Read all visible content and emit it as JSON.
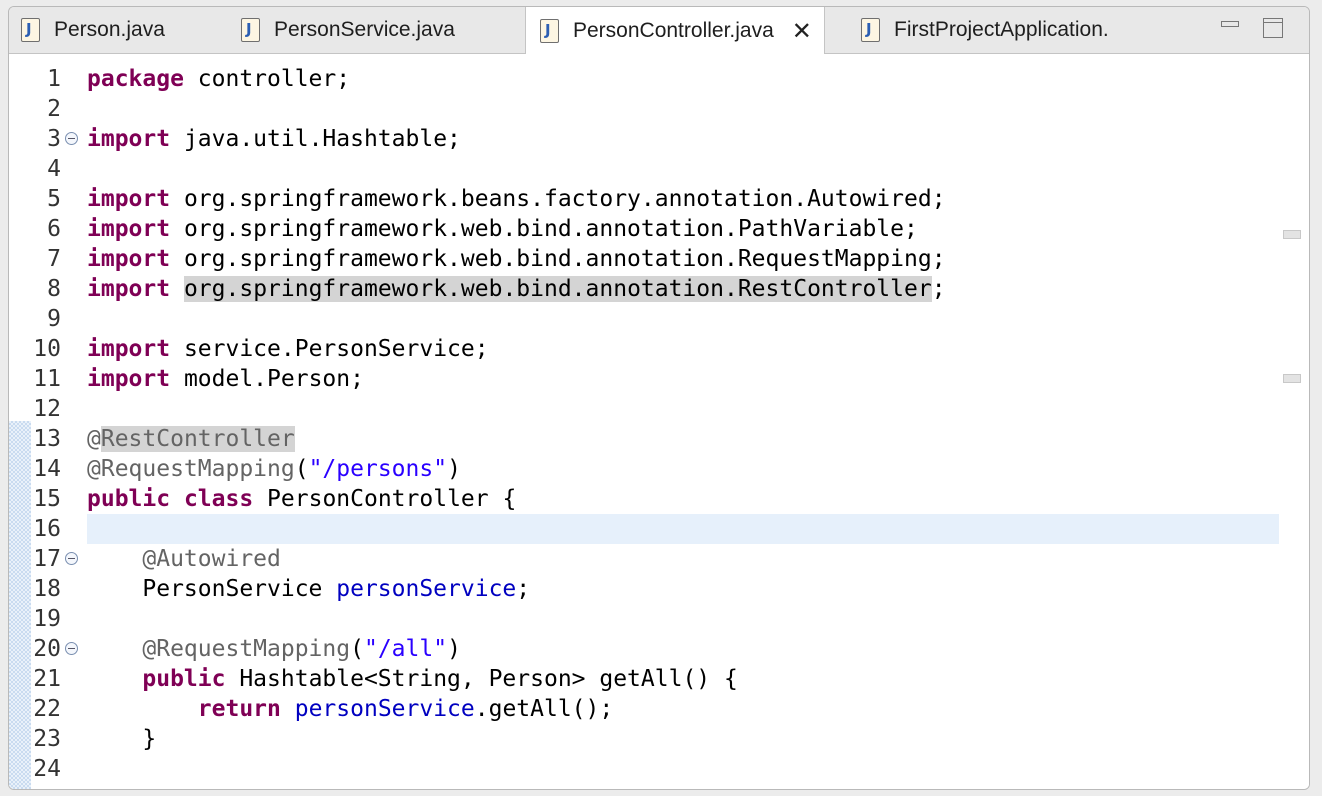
{
  "tabs": [
    {
      "label": "Person.java"
    },
    {
      "label": "PersonService.java"
    },
    {
      "label": "PersonController.java"
    },
    {
      "label": "FirstProjectApplication."
    }
  ],
  "editor": {
    "lines": [
      {
        "n": "1",
        "html": "<span class=\"kw\">package</span> controller;"
      },
      {
        "n": "2",
        "html": ""
      },
      {
        "n": "3",
        "html": "<span class=\"kw\">import</span> java.util.Hashtable;",
        "fold": true
      },
      {
        "n": "4",
        "html": ""
      },
      {
        "n": "5",
        "html": "<span class=\"kw\">import</span> org.springframework.beans.factory.annotation.Autowired;"
      },
      {
        "n": "6",
        "html": "<span class=\"kw\">import</span> org.springframework.web.bind.annotation.PathVariable;"
      },
      {
        "n": "7",
        "html": "<span class=\"kw\">import</span> org.springframework.web.bind.annotation.RequestMapping;"
      },
      {
        "n": "8",
        "html": "<span class=\"kw\">import</span> <span class=\"hl\">org.springframework.web.bind.annotation.RestController</span>;"
      },
      {
        "n": "9",
        "html": ""
      },
      {
        "n": "10",
        "html": "<span class=\"kw\">import</span> service.PersonService;"
      },
      {
        "n": "11",
        "html": "<span class=\"kw\">import</span> model.Person;"
      },
      {
        "n": "12",
        "html": ""
      },
      {
        "n": "13",
        "html": "<span class=\"ann\">@<span class=\"hl\">RestController</span></span>"
      },
      {
        "n": "14",
        "html": "<span class=\"ann\">@RequestMapping</span>(<span class=\"str\">\"/persons\"</span>)"
      },
      {
        "n": "15",
        "html": "<span class=\"kw\">public</span> <span class=\"kw\">class</span> PersonController {"
      },
      {
        "n": "16",
        "html": "",
        "current": true
      },
      {
        "n": "17",
        "html": "    <span class=\"ann\">@Autowired</span>",
        "fold": true
      },
      {
        "n": "18",
        "html": "    PersonService <span class=\"fld\">personService</span>;"
      },
      {
        "n": "19",
        "html": ""
      },
      {
        "n": "20",
        "html": "    <span class=\"ann\">@RequestMapping</span>(<span class=\"str\">\"/all\"</span>)",
        "fold": true
      },
      {
        "n": "21",
        "html": "    <span class=\"kw\">public</span> Hashtable&lt;String, Person&gt; getAll() {"
      },
      {
        "n": "22",
        "html": "        <span class=\"kw\">return</span> <span class=\"fld\">personService</span>.getAll();"
      },
      {
        "n": "23",
        "html": "    }"
      },
      {
        "n": "24",
        "html": ""
      }
    ]
  },
  "colors": {
    "keyword": "#7f0055",
    "annotation": "#646464",
    "string": "#2a00ff",
    "field": "#0000c0",
    "current_line": "#e6f0fb",
    "occurrence_highlight": "#d4d4d4"
  },
  "icons": [
    "java-file-icon",
    "close-icon",
    "minimize-icon",
    "maximize-icon",
    "fold-collapse-icon"
  ]
}
